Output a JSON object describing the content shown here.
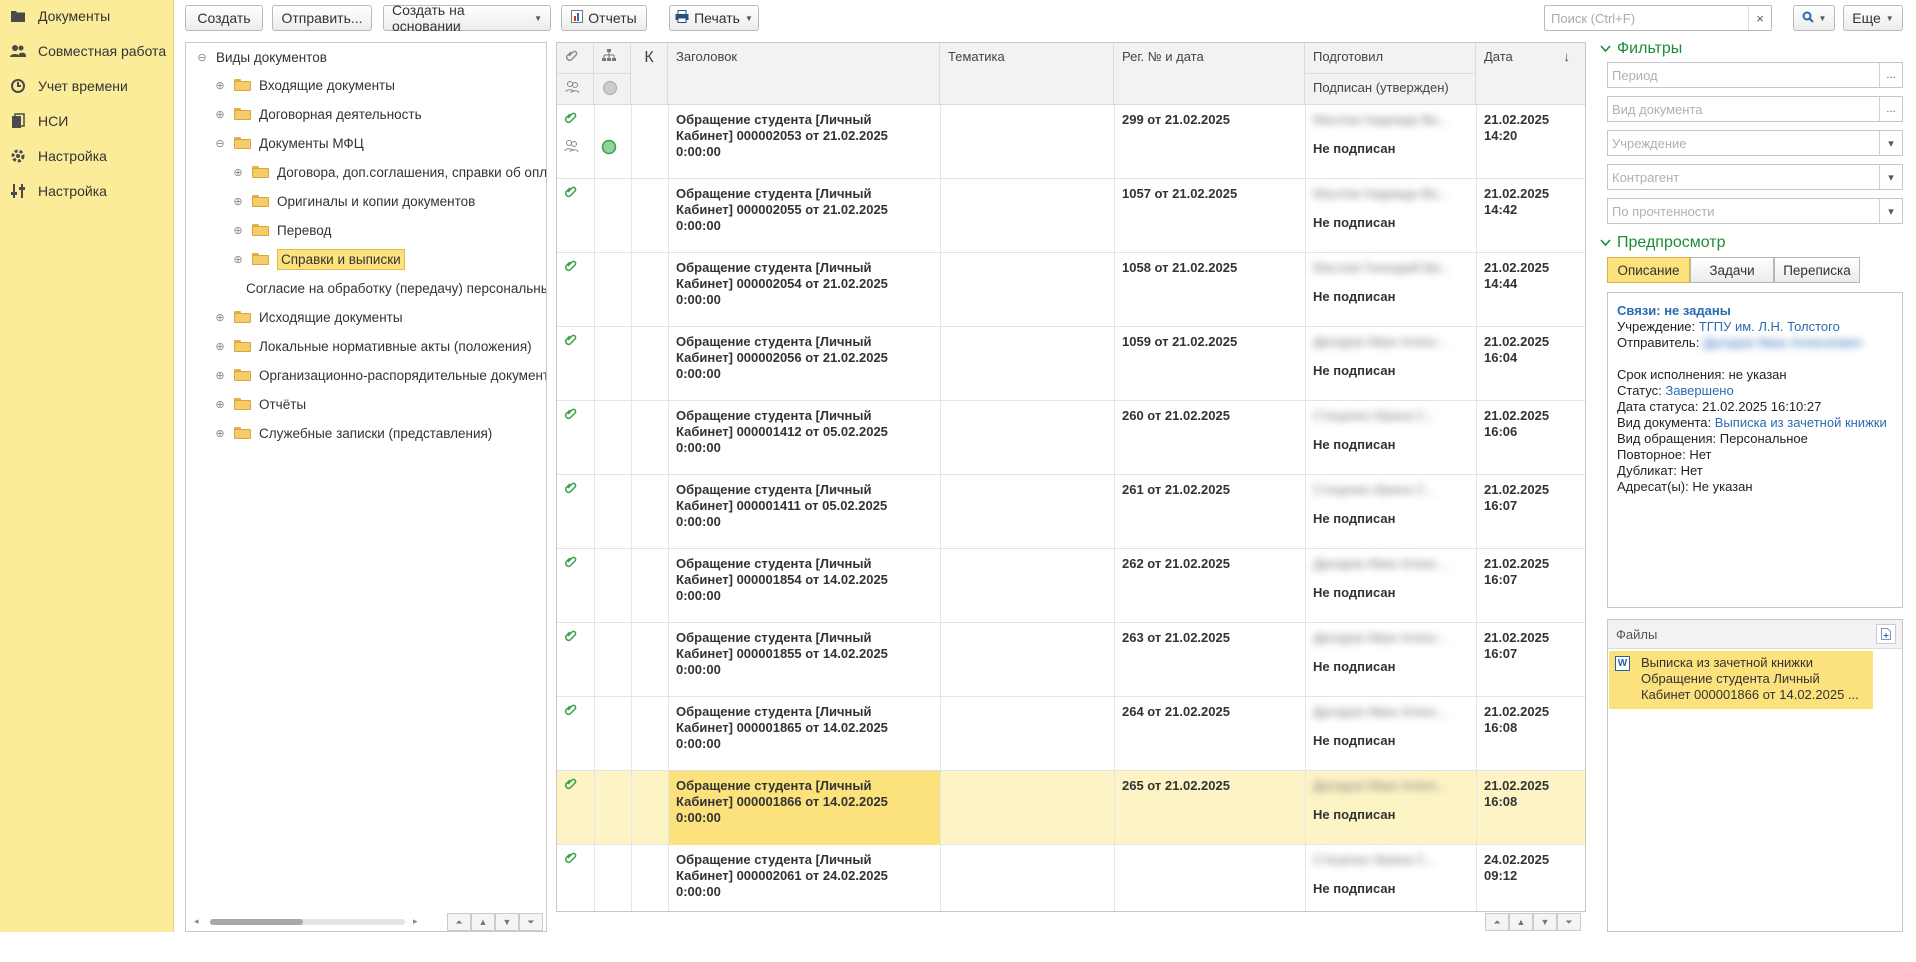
{
  "nav": {
    "items": [
      {
        "label": "Документы",
        "icon": "documents-icon"
      },
      {
        "label": "Совместная работа",
        "icon": "users-icon"
      },
      {
        "label": "Учет времени",
        "icon": "time-icon"
      },
      {
        "label": "НСИ",
        "icon": "reference-icon"
      },
      {
        "label": "Настройка",
        "icon": "gear-icon"
      },
      {
        "label": "Настройка",
        "icon": "sliders-icon"
      }
    ]
  },
  "toolbar": {
    "create": "Создать",
    "send": "Отправить...",
    "create_based": "Создать на основании",
    "reports": "Отчеты",
    "print": "Печать",
    "search_placeholder": "Поиск (Ctrl+F)",
    "clear": "×",
    "more": "Еще"
  },
  "tree": {
    "root": "Виды документов",
    "items": [
      {
        "label": "Входящие документы",
        "toggle": "⊕",
        "folder": true
      },
      {
        "label": "Договорная деятельность",
        "toggle": "⊕",
        "folder": true
      },
      {
        "label": "Документы МФЦ",
        "toggle": "⊖",
        "folder": true
      },
      {
        "label": "Договора, доп.соглашения, справки об оплате",
        "toggle": "⊕",
        "folder": true
      },
      {
        "label": "Оригиналы и копии документов",
        "toggle": "⊕",
        "folder": true
      },
      {
        "label": "Перевод",
        "toggle": "⊕",
        "folder": true
      },
      {
        "label": "Справки и выписки",
        "toggle": "⊕",
        "folder": true
      },
      {
        "label": "Согласие на обработку (передачу) персональных данных",
        "toggle": "",
        "folder": false
      },
      {
        "label": "Исходящие документы",
        "toggle": "⊕",
        "folder": true
      },
      {
        "label": "Локальные нормативные акты (положения)",
        "toggle": "⊕",
        "folder": true
      },
      {
        "label": "Организационно-распорядительные документы",
        "toggle": "⊕",
        "folder": true
      },
      {
        "label": "Отчёты",
        "toggle": "⊕",
        "folder": true
      },
      {
        "label": "Служебные записки (представления)",
        "toggle": "⊕",
        "folder": true
      }
    ]
  },
  "grid": {
    "headers": {
      "k": "К",
      "title": "Заголовок",
      "topic": "Тематика",
      "reg": "Рег. № и дата",
      "prepared": "Подготовил",
      "signed": "Подписан (утвержден)",
      "date": "Дата",
      "sort": "↓"
    },
    "rows": [
      {
        "title": "Обращение студента [Личный Кабинет] 000002053 от 21.02.2025 0:00:00",
        "reg": "299 от 21.02.2025",
        "preparer": "Маслов Надежда Ва...",
        "status": "Не подписан",
        "date": "21.02.2025",
        "time": "14:20"
      },
      {
        "title": "Обращение студента [Личный Кабинет] 000002055 от 21.02.2025 0:00:00",
        "reg": "1057 от 21.02.2025",
        "preparer": "Маслов Надежда Ва...",
        "status": "Не подписан",
        "date": "21.02.2025",
        "time": "14:42"
      },
      {
        "title": "Обращение студента [Личный Кабинет] 000002054 от 21.02.2025 0:00:00",
        "reg": "1058 от 21.02.2025",
        "preparer": "Маслов Геннадий Ва...",
        "status": "Не подписан",
        "date": "21.02.2025",
        "time": "14:44"
      },
      {
        "title": "Обращение студента [Личный Кабинет] 000002056 от 21.02.2025 0:00:00",
        "reg": "1059 от 21.02.2025",
        "preparer": "Дроздов Иван Алекс...",
        "status": "Не подписан",
        "date": "21.02.2025",
        "time": "16:04"
      },
      {
        "title": "Обращение студента [Личный Кабинет] 000001412 от 05.02.2025 0:00:00",
        "reg": "260 от 21.02.2025",
        "preparer": "Стеценко Ирина С...",
        "status": "Не подписан",
        "date": "21.02.2025",
        "time": "16:06"
      },
      {
        "title": "Обращение студента [Личный Кабинет] 000001411 от 05.02.2025 0:00:00",
        "reg": "261 от 21.02.2025",
        "preparer": "Стеценко Ирина С...",
        "status": "Не подписан",
        "date": "21.02.2025",
        "time": "16:07"
      },
      {
        "title": "Обращение студента [Личный Кабинет] 000001854 от 14.02.2025 0:00:00",
        "reg": "262 от 21.02.2025",
        "preparer": "Дроздов Иван Алекс...",
        "status": "Не подписан",
        "date": "21.02.2025",
        "time": "16:07"
      },
      {
        "title": "Обращение студента [Личный Кабинет] 000001855 от 14.02.2025 0:00:00",
        "reg": "263 от 21.02.2025",
        "preparer": "Дроздов Иван Алекс...",
        "status": "Не подписан",
        "date": "21.02.2025",
        "time": "16:07"
      },
      {
        "title": "Обращение студента [Личный Кабинет] 000001865 от 14.02.2025 0:00:00",
        "reg": "264 от 21.02.2025",
        "preparer": "Дроздов Иван Алекс...",
        "status": "Не подписан",
        "date": "21.02.2025",
        "time": "16:08"
      },
      {
        "title": "Обращение студента [Личный Кабинет] 000001866 от 14.02.2025 0:00:00",
        "reg": "265 от 21.02.2025",
        "preparer": "Дроздов Иван Алекс...",
        "status": "Не подписан",
        "date": "21.02.2025",
        "time": "16:08"
      },
      {
        "title": "Обращение студента [Личный Кабинет] 000002061 от 24.02.2025 0:00:00",
        "reg": "",
        "preparer": "Стеценко Ирина С...",
        "status": "Не подписан",
        "date": "24.02.2025",
        "time": "09:12"
      }
    ]
  },
  "filters": {
    "title": "Фильтры",
    "period": "Период",
    "doc_type": "Вид документа",
    "institution": "Учреждение",
    "counterparty": "Контрагент",
    "read_status": "По прочтенности"
  },
  "preview": {
    "title": "Предпросмотр",
    "tabs": [
      "Описание",
      "Задачи",
      "Переписка"
    ],
    "links": "Связи: не заданы",
    "institution_label": "Учреждение:",
    "institution": "ТГПУ им. Л.Н. Толстого",
    "sender_label": "Отправитель:",
    "sender": "Дроздов Иван Алексеевич",
    "deadline_label": "Срок исполнения:",
    "deadline": "не указан",
    "status_label": "Статус:",
    "status": "Завершено",
    "status_date_label": "Дата статуса:",
    "status_date": "21.02.2025 16:10:27",
    "doc_kind_label": "Вид документа:",
    "doc_kind": "Выписка из зачетной книжки",
    "request_kind_label": "Вид обращения:",
    "request_kind": "Персональное",
    "repeat_label": "Повторное:",
    "repeat": "Нет",
    "duplicate_label": "Дубликат:",
    "duplicate": "Нет",
    "addressee_label": "Адресат(ы):",
    "addressee": "Не указан"
  },
  "files": {
    "title": "Файлы",
    "item": "Выписка из зачетной книжки Обращение студента  Личный Кабинет  000001866 от 14.02.2025 ..."
  },
  "colors": {
    "accent_yellow": "#fbec9a",
    "selection": "#fbe27c",
    "green": "#1b8d37",
    "link": "#2a6bb3"
  }
}
